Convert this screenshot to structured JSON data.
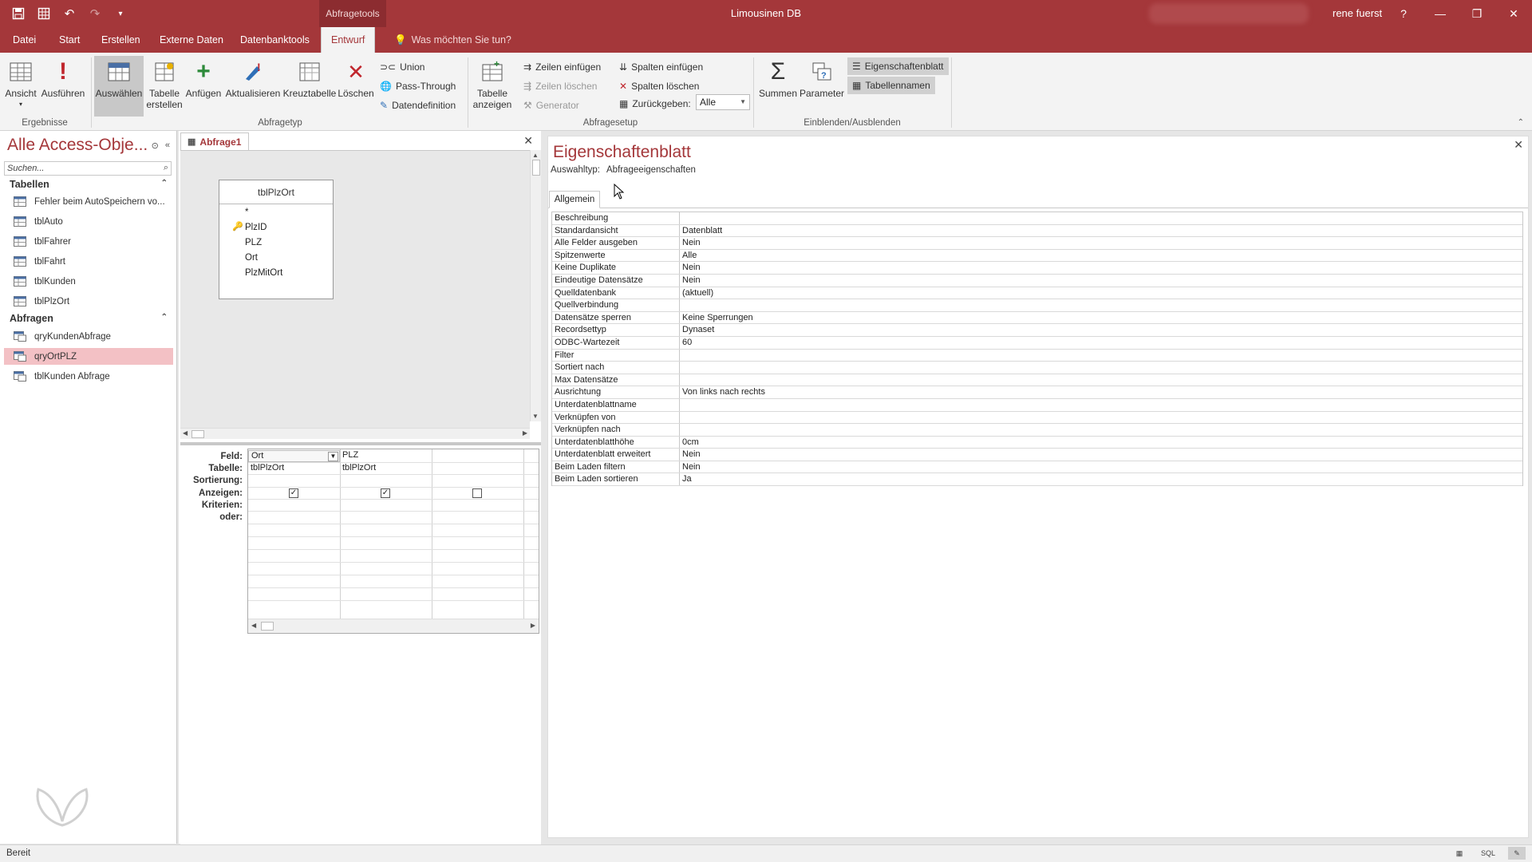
{
  "titlebar": {
    "context_tab": "Abfragetools",
    "app_title": "Limousinen DB",
    "user": "rene fuerst",
    "help": "?"
  },
  "tabs": {
    "items": [
      "Datei",
      "Start",
      "Erstellen",
      "Externe Daten",
      "Datenbanktools",
      "Entwurf"
    ],
    "active": "Entwurf",
    "tell_me": "Was möchten Sie tun?"
  },
  "ribbon": {
    "ergebnisse": {
      "label": "Ergebnisse",
      "ansicht": "Ansicht",
      "ausfuehren": "Ausführen"
    },
    "abfragetyp": {
      "label": "Abfragetyp",
      "auswaehlen": "Auswählen",
      "tabelle_erstellen_1": "Tabelle",
      "tabelle_erstellen_2": "erstellen",
      "anfuegen": "Anfügen",
      "aktualisieren": "Aktualisieren",
      "kreuztabelle": "Kreuztabelle",
      "loeschen": "Löschen",
      "union": "Union",
      "pass_through": "Pass-Through",
      "datendefinition": "Datendefinition"
    },
    "abfragesetup": {
      "label": "Abfragesetup",
      "tabelle_anzeigen_1": "Tabelle",
      "tabelle_anzeigen_2": "anzeigen",
      "zeilen_einfuegen": "Zeilen einfügen",
      "zeilen_loeschen": "Zeilen löschen",
      "generator": "Generator",
      "spalten_einfuegen": "Spalten einfügen",
      "spalten_loeschen": "Spalten löschen",
      "zurueckgeben": "Zurückgeben:",
      "zurueckgeben_value": "Alle"
    },
    "einblenden": {
      "label": "Einblenden/Ausblenden",
      "summen": "Summen",
      "parameter": "Parameter",
      "eigenschaftenblatt": "Eigenschaftenblatt",
      "tabellennamen": "Tabellennamen"
    }
  },
  "nav": {
    "title": "Alle Access-Obje...",
    "search_placeholder": "Suchen...",
    "sections": [
      {
        "name": "Tabellen",
        "items": [
          "Fehler beim AutoSpeichern vo...",
          "tblAuto",
          "tblFahrer",
          "tblFahrt",
          "tblKunden",
          "tblPlzOrt"
        ]
      },
      {
        "name": "Abfragen",
        "items": [
          "qryKundenAbfrage",
          "qryOrtPLZ",
          "tblKunden Abfrage"
        ]
      }
    ],
    "selected": "qryOrtPLZ"
  },
  "query": {
    "tab": "Abfrage1",
    "table_name": "tblPlzOrt",
    "fields": [
      "*",
      "PlzID",
      "PLZ",
      "Ort",
      "PlzMitOrt"
    ],
    "row_labels": [
      "Feld:",
      "Tabelle:",
      "Sortierung:",
      "Anzeigen:",
      "Kriterien:",
      "oder:"
    ],
    "columns": [
      {
        "feld": "Ort",
        "tabelle": "tblPlzOrt",
        "anzeigen": "✓"
      },
      {
        "feld": "PLZ",
        "tabelle": "tblPlzOrt",
        "anzeigen": "✓"
      },
      {
        "feld": "",
        "tabelle": "",
        "anzeigen": ""
      }
    ]
  },
  "props": {
    "title": "Eigenschaftenblatt",
    "selection_label": "Auswahltyp:",
    "selection_value": "Abfrageeigenschaften",
    "tab": "Allgemein",
    "rows": [
      [
        "Beschreibung",
        ""
      ],
      [
        "Standardansicht",
        "Datenblatt"
      ],
      [
        "Alle Felder ausgeben",
        "Nein"
      ],
      [
        "Spitzenwerte",
        "Alle"
      ],
      [
        "Keine Duplikate",
        "Nein"
      ],
      [
        "Eindeutige Datensätze",
        "Nein"
      ],
      [
        "Quelldatenbank",
        "(aktuell)"
      ],
      [
        "Quellverbindung",
        ""
      ],
      [
        "Datensätze sperren",
        "Keine Sperrungen"
      ],
      [
        "Recordsettyp",
        "Dynaset"
      ],
      [
        "ODBC-Wartezeit",
        "60"
      ],
      [
        "Filter",
        ""
      ],
      [
        "Sortiert nach",
        ""
      ],
      [
        "Max Datensätze",
        ""
      ],
      [
        "Ausrichtung",
        "Von links nach rechts"
      ],
      [
        "Unterdatenblattname",
        ""
      ],
      [
        "Verknüpfen von",
        ""
      ],
      [
        "Verknüpfen nach",
        ""
      ],
      [
        "Unterdatenblatthöhe",
        "0cm"
      ],
      [
        "Unterdatenblatt erweitert",
        "Nein"
      ],
      [
        "Beim Laden filtern",
        "Nein"
      ],
      [
        "Beim Laden sortieren",
        "Ja"
      ]
    ]
  },
  "status": {
    "text": "Bereit",
    "sql": "SQL"
  },
  "colors": {
    "accent": "#a4373a",
    "selected_nav": "#f3c1c5"
  }
}
